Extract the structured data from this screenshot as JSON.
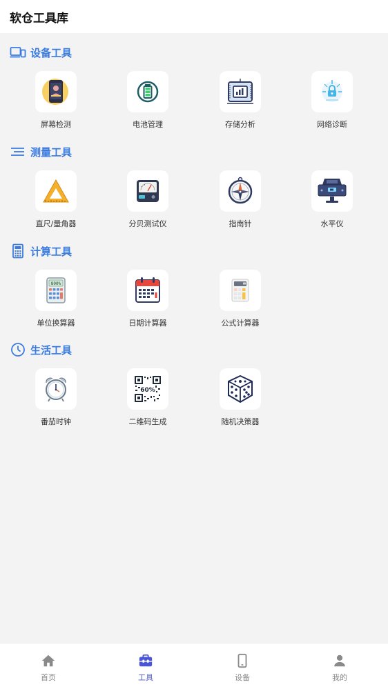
{
  "header": {
    "title": "软仓工具库"
  },
  "colors": {
    "accent": "#3a7be0",
    "tab_active": "#4a55d6",
    "tab_inactive": "#8a8a8a"
  },
  "sections": [
    {
      "title": "设备工具",
      "icon": "devices-icon",
      "tools": [
        {
          "label": "屏幕检测",
          "icon": "phone-screen-icon"
        },
        {
          "label": "电池管理",
          "icon": "battery-icon"
        },
        {
          "label": "存储分析",
          "icon": "storage-chip-icon"
        },
        {
          "label": "网络诊断",
          "icon": "network-lock-icon"
        }
      ]
    },
    {
      "title": "测量工具",
      "icon": "lines-icon",
      "tools": [
        {
          "label": "直尺/量角器",
          "icon": "triangle-ruler-icon"
        },
        {
          "label": "分贝测试仪",
          "icon": "decibel-meter-icon"
        },
        {
          "label": "指南针",
          "icon": "compass-icon"
        },
        {
          "label": "水平仪",
          "icon": "level-icon"
        }
      ]
    },
    {
      "title": "计算工具",
      "icon": "calculator-icon",
      "tools": [
        {
          "label": "单位换算器",
          "icon": "unit-calculator-icon",
          "display": "800%"
        },
        {
          "label": "日期计算器",
          "icon": "calendar-icon"
        },
        {
          "label": "公式计算器",
          "icon": "formula-calculator-icon"
        }
      ]
    },
    {
      "title": "生活工具",
      "icon": "clock-icon",
      "tools": [
        {
          "label": "番茄时钟",
          "icon": "alarm-clock-icon"
        },
        {
          "label": "二维码生成",
          "icon": "qr-code-icon",
          "display": "60%"
        },
        {
          "label": "随机决策器",
          "icon": "dice-icon"
        }
      ]
    }
  ],
  "tabbar": [
    {
      "label": "首页",
      "icon": "home-icon",
      "active": false
    },
    {
      "label": "工具",
      "icon": "toolbox-icon",
      "active": true
    },
    {
      "label": "设备",
      "icon": "device-icon",
      "active": false
    },
    {
      "label": "我的",
      "icon": "user-icon",
      "active": false
    }
  ]
}
